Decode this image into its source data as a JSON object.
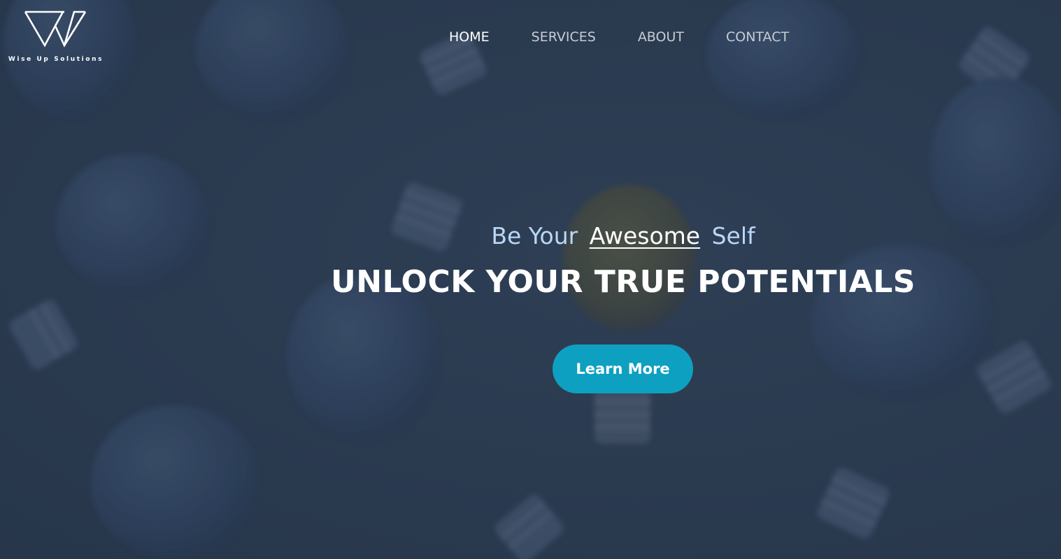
{
  "brand": {
    "logo_icon": "wiseup-w-logo-icon",
    "name": "Wise Up Solutions"
  },
  "nav": {
    "items": [
      {
        "label": "HOME",
        "active": true
      },
      {
        "label": "SERVICES",
        "active": false
      },
      {
        "label": "ABOUT",
        "active": false
      },
      {
        "label": "CONTACT",
        "active": false
      }
    ]
  },
  "hero": {
    "tagline_prefix": "Be Your",
    "tagline_accent": "Awesome",
    "tagline_suffix": "Self",
    "headline": "UNLOCK YOUR TRUE POTENTIALS",
    "cta_label": "Learn More",
    "background": "lightbulbs-background-image"
  },
  "colors": {
    "overlay": "#2c3c52",
    "tagline": "#b9d7f7",
    "cta": "#0ea0c1",
    "text": "#ffffff",
    "nav_inactive": "#c7ccd4"
  }
}
